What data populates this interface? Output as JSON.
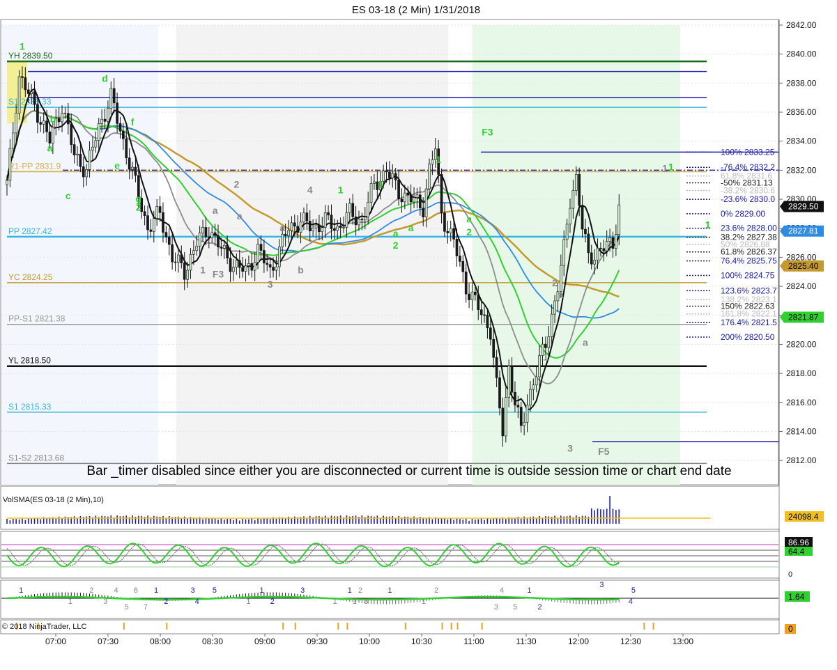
{
  "title": "ES 03-18 (2 Min)  1/31/2018",
  "copyright": "© 2018 NinjaTrader, LLC",
  "message": "Bar _timer disabled since either you are disconnected or current time is outside session time or chart end date",
  "chart_data": {
    "type": "candlestick",
    "title": "ES 03-18 (2 Min)  1/31/2018",
    "ylim": [
      2811,
      2842
    ],
    "y_ticks": [
      "2842.00",
      "2840.00",
      "2838.00",
      "2836.00",
      "2834.00",
      "2832.00",
      "2830.00",
      "2828.00",
      "2826.00",
      "2824.00",
      "2822.00",
      "2820.00",
      "2818.00",
      "2816.00",
      "2814.00",
      "2812.00"
    ],
    "y_tick_values": [
      2842,
      2840,
      2838,
      2836,
      2834,
      2832,
      2830,
      2828,
      2826,
      2824,
      2822,
      2820,
      2818,
      2816,
      2814,
      2812
    ],
    "x_ticks": [
      "07:00",
      "07:30",
      "08:00",
      "08:30",
      "09:00",
      "09:30",
      "10:00",
      "10:30",
      "11:00",
      "11:30",
      "12:00",
      "12:30",
      "13:00"
    ],
    "close_path": [
      [
        0,
        2831
      ],
      [
        4,
        2838.5
      ],
      [
        10,
        2836
      ],
      [
        14,
        2834
      ],
      [
        18,
        2836.5
      ],
      [
        22,
        2833
      ],
      [
        26,
        2832
      ],
      [
        30,
        2835
      ],
      [
        34,
        2837
      ],
      [
        38,
        2834
      ],
      [
        42,
        2831
      ],
      [
        46,
        2828
      ],
      [
        50,
        2829
      ],
      [
        54,
        2826
      ],
      [
        58,
        2825
      ],
      [
        62,
        2827
      ],
      [
        66,
        2828
      ],
      [
        70,
        2826.5
      ],
      [
        74,
        2825.5
      ],
      [
        78,
        2825
      ],
      [
        82,
        2826.5
      ],
      [
        86,
        2825
      ],
      [
        88,
        2826
      ],
      [
        92,
        2828
      ],
      [
        96,
        2828.5
      ],
      [
        100,
        2828
      ],
      [
        104,
        2828.5
      ],
      [
        108,
        2828
      ],
      [
        112,
        2829
      ],
      [
        116,
        2828.5
      ],
      [
        120,
        2831
      ],
      [
        124,
        2832
      ],
      [
        128,
        2830.5
      ],
      [
        132,
        2830
      ],
      [
        136,
        2829.5
      ],
      [
        138,
        2832
      ],
      [
        140,
        2833.5
      ],
      [
        142,
        2829
      ],
      [
        146,
        2827
      ],
      [
        150,
        2824
      ],
      [
        154,
        2822.5
      ],
      [
        158,
        2821
      ],
      [
        160,
        2817
      ],
      [
        162,
        2814
      ],
      [
        164,
        2818.5
      ],
      [
        166,
        2816
      ],
      [
        168,
        2814
      ],
      [
        170,
        2816
      ],
      [
        172,
        2817.5
      ],
      [
        176,
        2820
      ],
      [
        180,
        2824
      ],
      [
        182,
        2826.5
      ],
      [
        184,
        2830
      ],
      [
        186,
        2831.5
      ],
      [
        188,
        2828
      ],
      [
        190,
        2826
      ],
      [
        194,
        2826.5
      ],
      [
        198,
        2827
      ],
      [
        200,
        2829.5
      ]
    ],
    "n_bars": 200,
    "levels": [
      {
        "name": "YH",
        "label": "YH 2839.50",
        "value": 2839.5,
        "color": "#1a6b1a"
      },
      {
        "name": "R2",
        "label": "",
        "value": 2838.8,
        "color": "#1c1ca8"
      },
      {
        "name": "R1b",
        "label": "",
        "value": 2837.0,
        "color": "#1c1ca8"
      },
      {
        "name": "S1",
        "label": "S1 2836.33",
        "value": 2836.33,
        "color": "#36b6e0"
      },
      {
        "name": "R1-PP",
        "label": "R1-PP 2831.9",
        "value": 2831.9,
        "color": "#d4b040"
      },
      {
        "name": "PP",
        "label": "PP 2827.42",
        "value": 2827.42,
        "color": "#36b6e0"
      },
      {
        "name": "YC",
        "label": "YC 2824.25",
        "value": 2824.25,
        "color": "#c49a30"
      },
      {
        "name": "PP-S1",
        "label": "PP-S1 2821.38",
        "value": 2821.38,
        "color": "#999999"
      },
      {
        "name": "YL",
        "label": "YL 2818.50",
        "value": 2818.5,
        "color": "#111111"
      },
      {
        "name": "S1b",
        "label": "S1 2815.33",
        "value": 2815.33,
        "color": "#36b6e0"
      },
      {
        "name": "S1-S2",
        "label": "S1-S2 2813.68",
        "value": 2811.8,
        "color": "#888888"
      }
    ],
    "fib_levels": [
      {
        "label": "100%  2833.25",
        "value": 2833.25,
        "color": "#1c1ca8"
      },
      {
        "label": "-76.4%  2832.2",
        "value": 2832.2,
        "color": "#1c1ca8"
      },
      {
        "label": "61.8%  2831.6",
        "value": 2831.6,
        "color": "#bbbbbb"
      },
      {
        "label": "-50%  2831.13",
        "value": 2831.13,
        "color": "#222222"
      },
      {
        "label": "-38.2%  2830.6",
        "value": 2830.6,
        "color": "#bbbbbb"
      },
      {
        "label": "-23.6%  2830.0",
        "value": 2830.0,
        "color": "#1c1ca8"
      },
      {
        "label": "0%  2829.00",
        "value": 2829.0,
        "color": "#1c1ca8"
      },
      {
        "label": "23.6%  2828.00",
        "value": 2828.0,
        "color": "#1c1ca8"
      },
      {
        "label": "38.2%  2827.38",
        "value": 2827.38,
        "color": "#222222"
      },
      {
        "label": "50%  2826.88",
        "value": 2826.88,
        "color": "#bbbbbb"
      },
      {
        "label": "61.8%  2826.37",
        "value": 2826.37,
        "color": "#222222"
      },
      {
        "label": "76.4%  2825.75",
        "value": 2825.75,
        "color": "#1c1ca8"
      },
      {
        "label": "100%  2824.75",
        "value": 2824.75,
        "color": "#1c1ca8"
      },
      {
        "label": "123.6%  2823.7",
        "value": 2823.7,
        "color": "#1c1ca8"
      },
      {
        "label": "138.2%  2823.1",
        "value": 2823.1,
        "color": "#bbbbbb"
      },
      {
        "label": "150%  2822.63",
        "value": 2822.63,
        "color": "#222222"
      },
      {
        "label": "161.8%  2822.1",
        "value": 2822.1,
        "color": "#bbbbbb"
      },
      {
        "label": "176.4%  2821.5",
        "value": 2821.5,
        "color": "#1c1ca8"
      },
      {
        "label": "200%  2820.50",
        "value": 2820.5,
        "color": "#1c1ca8"
      }
    ],
    "price_badges": [
      {
        "text": "2829.50",
        "value": 2829.5,
        "bg": "#111111",
        "fg": "#ffffff"
      },
      {
        "text": "2827.81",
        "value": 2827.81,
        "bg": "#2e8be0",
        "fg": "#ffffff"
      },
      {
        "text": "2825.40",
        "value": 2825.4,
        "bg": "#c49a30",
        "fg": "#000000"
      },
      {
        "text": "2821.87",
        "value": 2821.87,
        "bg": "#2fd02f",
        "fg": "#000000"
      }
    ],
    "wave_labels": [
      {
        "text": "1",
        "value": 2840.3,
        "bar": 5,
        "color": "#2fd02f"
      },
      {
        "text": "d",
        "value": 2838.1,
        "bar": 32,
        "color": "#2fd02f"
      },
      {
        "text": "b",
        "value": 2835.3,
        "bar": 15,
        "color": "#2fd02f"
      },
      {
        "text": "f",
        "value": 2835.1,
        "bar": 41,
        "color": "#2fd02f"
      },
      {
        "text": "a",
        "value": 2833.3,
        "bar": 14,
        "color": "#2fd02f"
      },
      {
        "text": "e",
        "value": 2832.1,
        "bar": 36,
        "color": "#2fd02f"
      },
      {
        "text": "c",
        "value": 2830.0,
        "bar": 20,
        "color": "#2fd02f"
      },
      {
        "text": "g",
        "value": 2829.8,
        "bar": 43,
        "color": "#2fd02f"
      },
      {
        "text": "2",
        "value": 2829.2,
        "bar": 43,
        "color": "#2fd02f"
      },
      {
        "text": "2",
        "value": 2830.8,
        "bar": 75,
        "color": "#888888"
      },
      {
        "text": "a",
        "value": 2829.0,
        "bar": 68,
        "color": "#888888"
      },
      {
        "text": "a",
        "value": 2828.6,
        "bar": 76,
        "color": "#888888"
      },
      {
        "text": "a",
        "value": 2827.8,
        "bar": 90,
        "color": "#888888"
      },
      {
        "text": "1",
        "value": 2824.9,
        "bar": 64,
        "color": "#888888"
      },
      {
        "text": "F3",
        "value": 2824.6,
        "bar": 69,
        "color": "#888888"
      },
      {
        "text": "3",
        "value": 2823.9,
        "bar": 86,
        "color": "#888888"
      },
      {
        "text": "b",
        "value": 2824.9,
        "bar": 96,
        "color": "#888888"
      },
      {
        "text": "4",
        "value": 2830.4,
        "bar": 99,
        "color": "#888888"
      },
      {
        "text": "1",
        "value": 2830.4,
        "bar": 109,
        "color": "#2fd02f"
      },
      {
        "text": "1",
        "value": 2830.8,
        "bar": 122,
        "color": "#2fd02f"
      },
      {
        "text": "a",
        "value": 2827.4,
        "bar": 127,
        "color": "#2fd02f"
      },
      {
        "text": "a",
        "value": 2827.8,
        "bar": 132,
        "color": "#2fd02f"
      },
      {
        "text": "2",
        "value": 2826.6,
        "bar": 127,
        "color": "#2fd02f"
      },
      {
        "text": "1",
        "value": 2832.5,
        "bar": 141,
        "color": "#2fd02f"
      },
      {
        "text": "a",
        "value": 2828.4,
        "bar": 151,
        "color": "#2fd02f"
      },
      {
        "text": "2",
        "value": 2827.5,
        "bar": 151,
        "color": "#2fd02f"
      },
      {
        "text": "F3",
        "value": 2834.4,
        "bar": 157,
        "color": "#2fd02f"
      },
      {
        "text": "2",
        "value": 2824.0,
        "bar": 179,
        "color": "#888888"
      },
      {
        "text": "a",
        "value": 2823.2,
        "bar": 181,
        "color": "#888888"
      },
      {
        "text": "1",
        "value": 2818.9,
        "bar": 176,
        "color": "#888888"
      },
      {
        "text": "a",
        "value": 2819.9,
        "bar": 189,
        "color": "#888888"
      },
      {
        "text": "3",
        "value": 2812.6,
        "bar": 184,
        "color": "#888888"
      },
      {
        "text": "F5",
        "value": 2812.4,
        "bar": 195,
        "color": "#888888"
      },
      {
        "text": "1",
        "value": 2831.9,
        "bar": 215,
        "color": "#888888"
      },
      {
        "text": "1",
        "value": 2832.0,
        "bar": 217,
        "color": "#2fd02f"
      },
      {
        "text": "1",
        "value": 2828.0,
        "bar": 229,
        "color": "#2fd02f"
      }
    ],
    "panels": [
      {
        "name": "VolSMA",
        "label": "VolSMA(ES 03-18 (2 Min),10)",
        "badge": "24098.4",
        "badge_bg": "#f0c020",
        "badge_fg": "#000000"
      },
      {
        "name": "Stochastic",
        "label": "",
        "badge_top": "86.96",
        "badge_mid": "64.4",
        "tick": "0"
      },
      {
        "name": "Waves",
        "label": "",
        "badge": "1.64",
        "badge_bg": "#2fd02f"
      },
      {
        "name": "Bottom",
        "label": "",
        "badge": "0",
        "badge_bg": "#f0a020"
      }
    ],
    "osc_wave_labels": [
      {
        "text": "1",
        "pos": 0.02,
        "dy": -1,
        "color": "#1c1ca8"
      },
      {
        "text": "1",
        "pos": 0.09,
        "dy": 1,
        "color": "#888888"
      },
      {
        "text": "2",
        "pos": 0.12,
        "dy": -1,
        "color": "#888888"
      },
      {
        "text": "3",
        "pos": 0.14,
        "dy": 1,
        "color": "#888888"
      },
      {
        "text": "4",
        "pos": 0.155,
        "dy": -1,
        "color": "#888888"
      },
      {
        "text": "5",
        "pos": 0.17,
        "dy": 2,
        "color": "#888888"
      },
      {
        "text": "6",
        "pos": 0.183,
        "dy": -1,
        "color": "#888888"
      },
      {
        "text": "7",
        "pos": 0.197,
        "dy": 2,
        "color": "#888888"
      },
      {
        "text": "1",
        "pos": 0.212,
        "dy": -1,
        "color": "#1c1ca8"
      },
      {
        "text": "2",
        "pos": 0.226,
        "dy": 1,
        "color": "#1c1ca8"
      },
      {
        "text": "3",
        "pos": 0.264,
        "dy": -1,
        "color": "#1c1ca8"
      },
      {
        "text": "4",
        "pos": 0.27,
        "dy": 1,
        "color": "#1c1ca8"
      },
      {
        "text": "5",
        "pos": 0.295,
        "dy": -1,
        "color": "#1c1ca8"
      },
      {
        "text": "1",
        "pos": 0.343,
        "dy": 1,
        "color": "#888888"
      },
      {
        "text": "1",
        "pos": 0.362,
        "dy": -1,
        "color": "#1c1ca8"
      },
      {
        "text": "2",
        "pos": 0.377,
        "dy": 1,
        "color": "#1c1ca8"
      },
      {
        "text": "3",
        "pos": 0.42,
        "dy": -1,
        "color": "#1c1ca8"
      },
      {
        "text": "1",
        "pos": 0.466,
        "dy": 1,
        "color": "#888888"
      },
      {
        "text": "1",
        "pos": 0.487,
        "dy": -1,
        "color": "#1c1ca8"
      },
      {
        "text": "2",
        "pos": 0.502,
        "dy": -1,
        "color": "#888888"
      },
      {
        "text": "1",
        "pos": 0.494,
        "dy": 1,
        "color": "#888888"
      },
      {
        "text": "3",
        "pos": 0.51,
        "dy": 1,
        "color": "#888888"
      },
      {
        "text": "1",
        "pos": 0.544,
        "dy": -1,
        "color": "#1c1ca8"
      },
      {
        "text": "1",
        "pos": 0.592,
        "dy": 1,
        "color": "#888888"
      },
      {
        "text": "2",
        "pos": 0.61,
        "dy": -1,
        "color": "#888888"
      },
      {
        "text": "4",
        "pos": 0.703,
        "dy": -1,
        "color": "#888888"
      },
      {
        "text": "3",
        "pos": 0.695,
        "dy": 2,
        "color": "#888888"
      },
      {
        "text": "5",
        "pos": 0.722,
        "dy": 2,
        "color": "#888888"
      },
      {
        "text": "1",
        "pos": 0.742,
        "dy": -1,
        "color": "#1c1ca8"
      },
      {
        "text": "2",
        "pos": 0.757,
        "dy": 2,
        "color": "#1c1ca8"
      },
      {
        "text": "3",
        "pos": 0.845,
        "dy": -2,
        "color": "#1c1ca8"
      },
      {
        "text": "5",
        "pos": 0.89,
        "dy": -1,
        "color": "#1c1ca8"
      },
      {
        "text": "4",
        "pos": 0.886,
        "dy": 1,
        "color": "#1c1ca8"
      }
    ],
    "colors": {
      "up_candle": "#c8e6c8",
      "down_candle": "#1a1a1a",
      "session_green": "#e8f8e8",
      "session_gray": "#f3f3f3",
      "session_blue": "#f3f6fc",
      "ma_black": "#111111",
      "ma_gray": "#8c8c8c",
      "ma_green": "#2fd02f",
      "ma_gold": "#c49a30",
      "ma_blue": "#2e8be0"
    }
  }
}
